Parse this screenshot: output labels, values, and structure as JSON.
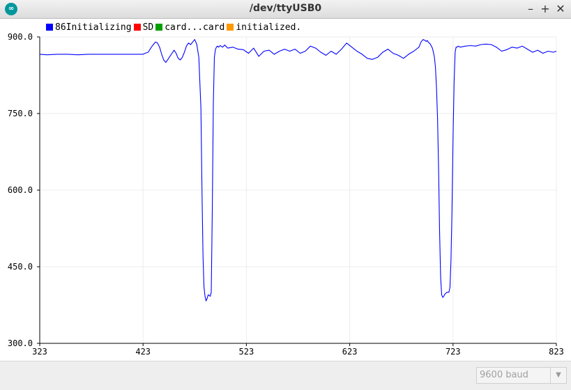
{
  "window": {
    "title": "/dev/ttyUSB0",
    "icon": "arduino-icon",
    "buttons": [
      "–",
      "+",
      "✕"
    ]
  },
  "legend": [
    {
      "label": "86Initializing",
      "color": "#0000ff"
    },
    {
      "label": "SD",
      "color": "#ff0000"
    },
    {
      "label": "card...card",
      "color": "#00a000"
    },
    {
      "label": "initialized.",
      "color": "#ff9900"
    }
  ],
  "baud": {
    "value": "9600 baud"
  },
  "chart_data": {
    "type": "line",
    "title": "",
    "xlabel": "",
    "ylabel": "",
    "xlim": [
      323,
      823
    ],
    "ylim": [
      300,
      900
    ],
    "xticks": [
      323,
      423,
      523,
      623,
      723,
      823
    ],
    "yticks": [
      300,
      450,
      600,
      750,
      900
    ],
    "xtick_labels": [
      "323",
      "423",
      "523",
      "623",
      "723",
      "823"
    ],
    "ytick_labels": [
      "300.0",
      "450.0",
      "600.0",
      "750.0",
      "900.0"
    ],
    "grid": true,
    "series": [
      {
        "name": "86Initializing",
        "color": "#0000ff",
        "x": [
          323,
          330,
          340,
          350,
          360,
          370,
          380,
          390,
          400,
          410,
          418,
          423,
          425,
          428,
          431,
          433,
          435,
          437,
          439,
          441,
          443,
          445,
          447,
          449,
          451,
          453,
          455,
          457,
          459,
          461,
          463,
          465,
          467,
          469,
          471,
          473,
          475,
          477,
          479,
          480,
          481,
          482,
          483,
          484,
          485,
          486,
          487,
          488,
          489,
          490,
          491,
          492,
          493,
          494,
          495,
          496,
          497,
          498,
          499,
          500,
          502,
          505,
          510,
          515,
          520,
          525,
          530,
          535,
          540,
          545,
          550,
          555,
          560,
          565,
          570,
          575,
          580,
          585,
          590,
          595,
          600,
          605,
          610,
          615,
          620,
          625,
          630,
          635,
          640,
          645,
          650,
          655,
          660,
          665,
          670,
          675,
          680,
          685,
          690,
          692,
          694,
          696,
          697,
          698,
          699,
          700,
          701,
          702,
          703,
          704,
          705,
          706,
          707,
          708,
          709,
          710,
          711,
          712,
          713,
          714,
          715,
          716,
          717,
          718,
          719,
          720,
          721,
          722,
          723,
          724,
          725,
          726,
          727,
          728,
          730,
          735,
          740,
          745,
          750,
          755,
          760,
          765,
          770,
          775,
          780,
          785,
          790,
          795,
          800,
          805,
          810,
          815,
          820,
          823
        ],
        "y": [
          866,
          865,
          866,
          866,
          865,
          866,
          866,
          866,
          866,
          866,
          866,
          866,
          868,
          870,
          880,
          885,
          890,
          888,
          880,
          866,
          855,
          850,
          856,
          862,
          868,
          874,
          868,
          858,
          855,
          860,
          870,
          882,
          888,
          885,
          890,
          895,
          885,
          860,
          760,
          600,
          470,
          410,
          392,
          383,
          388,
          395,
          394,
          392,
          400,
          560,
          770,
          860,
          875,
          880,
          882,
          880,
          882,
          883,
          881,
          880,
          884,
          878,
          880,
          876,
          875,
          868,
          878,
          862,
          872,
          874,
          866,
          872,
          876,
          872,
          876,
          868,
          872,
          882,
          878,
          870,
          864,
          872,
          866,
          876,
          888,
          880,
          872,
          866,
          858,
          856,
          860,
          870,
          876,
          868,
          864,
          858,
          866,
          872,
          880,
          890,
          895,
          893,
          891,
          893,
          890,
          888,
          886,
          882,
          878,
          870,
          860,
          840,
          800,
          740,
          640,
          520,
          430,
          395,
          390,
          392,
          396,
          398,
          400,
          400,
          400,
          410,
          460,
          560,
          700,
          810,
          870,
          880,
          880,
          882,
          880,
          882,
          883,
          882,
          885,
          886,
          885,
          880,
          872,
          875,
          880,
          878,
          882,
          876,
          870,
          874,
          868,
          872,
          870,
          872
        ]
      }
    ]
  }
}
